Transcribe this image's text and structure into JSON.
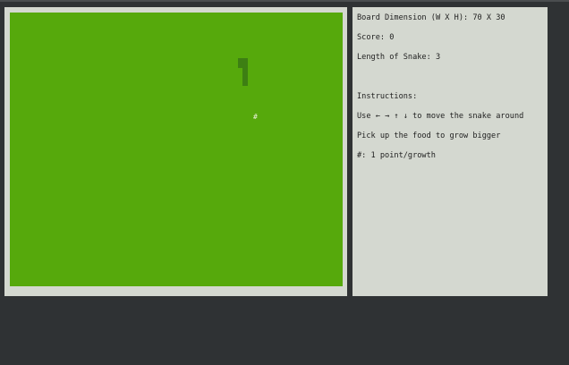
{
  "colors": {
    "board": "#56a90c",
    "snake": "#3d7f13",
    "panel": "#d4d8d0",
    "background": "#2f3234"
  },
  "game": {
    "board_cols": 70,
    "board_rows": 30,
    "snake_cells": [
      [
        49,
        5
      ],
      [
        49,
        6
      ],
      [
        49,
        7
      ]
    ],
    "food_cell": [
      51,
      11
    ],
    "food_char": "#"
  },
  "info": {
    "board_dimension": "Board Dimension (W X H): 70 X 30",
    "score": "Score: 0",
    "length": "Length of Snake: 3",
    "instructions_title": "Instructions:",
    "move_prefix": "Use",
    "arrow_keys": "← → ↑ ↓",
    "move_suffix": "to move the snake around",
    "pickup": "Pick up the food to grow bigger",
    "food_legend": "#: 1 point/growth"
  }
}
